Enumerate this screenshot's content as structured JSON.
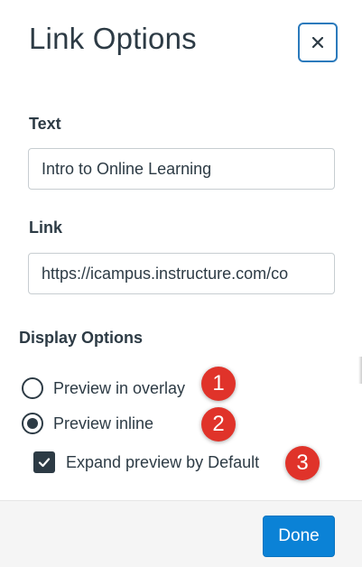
{
  "dialog": {
    "title": "Link Options",
    "close_label": "Close"
  },
  "text_field": {
    "label": "Text",
    "value": "Intro to Online Learning"
  },
  "link_field": {
    "label": "Link",
    "value": "https://icampus.instructure.com/co"
  },
  "display_options": {
    "label": "Display Options",
    "overlay_label": "Preview in overlay",
    "inline_label": "Preview inline",
    "expand_label": "Expand preview by Default",
    "selected": "inline",
    "expand_checked": true
  },
  "annotations": [
    "1",
    "2",
    "3"
  ],
  "footer": {
    "done_label": "Done"
  },
  "colors": {
    "accent": "#0b82d6",
    "badge": "#e0332a",
    "text": "#2d3b45"
  }
}
